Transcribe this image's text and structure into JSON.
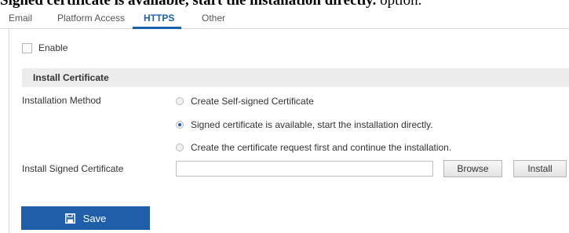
{
  "caption": {
    "bold_text": "Signed certificate is available, start the installation directly.",
    "plain_text": " option."
  },
  "tabs": [
    {
      "label": "Email",
      "active": false
    },
    {
      "label": "Platform Access",
      "active": false
    },
    {
      "label": "HTTPS",
      "active": true
    },
    {
      "label": "Other",
      "active": false
    }
  ],
  "enable": {
    "label": "Enable",
    "checked": false
  },
  "section": {
    "title": "Install Certificate"
  },
  "installation_method": {
    "label": "Installation Method",
    "options": [
      {
        "label": "Create Self-signed Certificate",
        "selected": false
      },
      {
        "label": "Signed certificate is available, start the installation directly.",
        "selected": true
      },
      {
        "label": "Create the certificate request first and continue the installation.",
        "selected": false
      }
    ]
  },
  "install_signed_certificate": {
    "label": "Install Signed Certificate",
    "value": "",
    "browse_label": "Browse",
    "install_label": "Install"
  },
  "save": {
    "label": "Save",
    "icon": "floppy-disk-icon"
  },
  "colors": {
    "accent": "#1f5fa9",
    "section_bg": "#ececec"
  }
}
